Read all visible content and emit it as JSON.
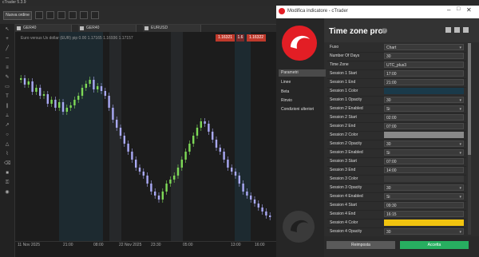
{
  "app": {
    "title": "cTrader 5.3.9",
    "new_order_label": "Nuova ordine",
    "tabs": [
      {
        "label": "GER40"
      },
      {
        "label": "GER40"
      },
      {
        "label": "EURUSD"
      }
    ],
    "chart_caption": "Euro versus Us dollar (EUR) pip 0.00  1.17165  1.16936  1.17157",
    "prices": {
      "bid": "1.16321",
      "mid": "1.6",
      "ask": "1.16322"
    },
    "date_labels": [
      "11 Nov 2025",
      "21:00",
      "08:00",
      "23:30",
      "22 Nov 2025",
      "05:00",
      "13:00",
      "16:00"
    ]
  },
  "dialog": {
    "title": "Modifica indicatore - cTrader",
    "heading": "Time zone pro",
    "help_icon": "help-icon",
    "sidebar": [
      "Parametri",
      "Linee",
      "Beta",
      "Rinvio",
      "Condizioni ulteriori"
    ],
    "rows": [
      {
        "label": "Fuso",
        "value": "Chart",
        "type": "select"
      },
      {
        "label": "Number Of Days",
        "value": "30",
        "type": "input"
      },
      {
        "label": "Time Zone",
        "value": "UTC_plus3",
        "type": "input"
      },
      {
        "label": "Session 1 Start",
        "value": "17:00",
        "type": "input"
      },
      {
        "label": "Session 1 End",
        "value": "21:00",
        "type": "input"
      },
      {
        "label": "Session 1 Color",
        "value": "",
        "type": "color",
        "color": "#1a3a4a"
      },
      {
        "label": "Session 1 Opacity",
        "value": "30",
        "type": "select"
      },
      {
        "label": "Session 2 Enabled",
        "value": "Si",
        "type": "select"
      },
      {
        "label": "Session 2 Start",
        "value": "02:00",
        "type": "input"
      },
      {
        "label": "Session 2 End",
        "value": "07:00",
        "type": "input"
      },
      {
        "label": "Session 2 Color",
        "value": "",
        "type": "color",
        "color": "#8a8a8a"
      },
      {
        "label": "Session 2 Opacity",
        "value": "30",
        "type": "select"
      },
      {
        "label": "Session 3 Enabled",
        "value": "Si",
        "type": "select"
      },
      {
        "label": "Session 3 Start",
        "value": "07:00",
        "type": "input"
      },
      {
        "label": "Session 3 End",
        "value": "14:00",
        "type": "input"
      },
      {
        "label": "Session 3 Color",
        "value": "",
        "type": "color",
        "color": "#3a3a3a"
      },
      {
        "label": "Session 3 Opacity",
        "value": "30",
        "type": "select"
      },
      {
        "label": "Session 4 Enabled",
        "value": "Si",
        "type": "select"
      },
      {
        "label": "Session 4 Start",
        "value": "09:30",
        "type": "input"
      },
      {
        "label": "Session 4 End",
        "value": "16:15",
        "type": "input"
      },
      {
        "label": "Session 4 Color",
        "value": "",
        "type": "color",
        "color": "#f1c40f"
      },
      {
        "label": "Session 4 Opacity",
        "value": "30",
        "type": "select"
      }
    ],
    "reset_label": "Reimposta",
    "accept_label": "Accetta"
  },
  "colors": {
    "accent_red": "#c0392b",
    "accept_green": "#27ae60",
    "candle_bull": "#7ed957",
    "candle_bear": "#a9a9f5"
  }
}
